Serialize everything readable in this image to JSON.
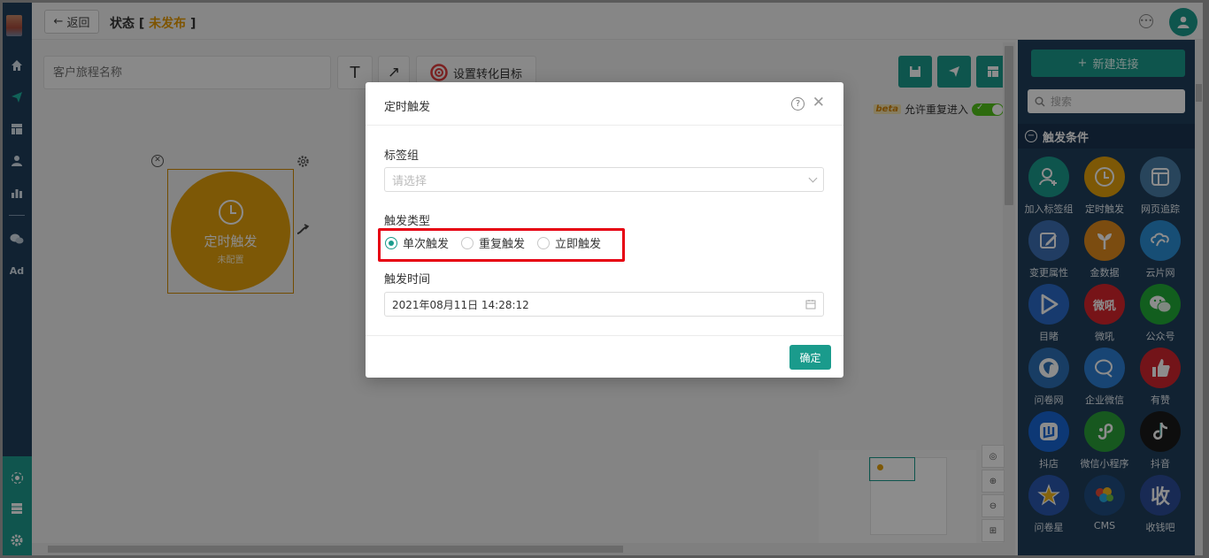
{
  "topbar": {
    "back_label": "返回",
    "status_prefix": "状态 [",
    "status_value": "未发布",
    "status_suffix": "]"
  },
  "leftnav": {
    "ad_label": "Ad",
    "icons": [
      "home-icon",
      "send-icon",
      "layout-icon",
      "user-icon",
      "bar-chart-icon",
      "wechat-icon",
      "settings-network-icon",
      "server-icon",
      "gear-icon"
    ]
  },
  "toolbar": {
    "journey_placeholder": "客户旅程名称",
    "goal_label": "设置转化目标",
    "beta_tag": "beta",
    "allow_reentry_label": "允许重复进入"
  },
  "node": {
    "title": "定时触发",
    "subtitle": "未配置"
  },
  "right_panel": {
    "new_connection_label": "新建连接",
    "search_placeholder": "搜索",
    "section_title": "触发条件",
    "items": [
      {
        "label": "加入标签组",
        "color": "#1a9b8c",
        "icon": "user-add-icon"
      },
      {
        "label": "定时触发",
        "color": "#e4a00b",
        "icon": "clock-icon"
      },
      {
        "label": "网页追踪",
        "color": "#4a7fa8",
        "icon": "webpage-icon"
      },
      {
        "label": "变更属性",
        "color": "#3d6fb5",
        "icon": "edit-icon"
      },
      {
        "label": "金数据",
        "color": "#e08a1e",
        "icon": "plant-icon"
      },
      {
        "label": "云片网",
        "color": "#2b8fd6",
        "icon": "cloud-link-icon"
      },
      {
        "label": "目睹",
        "color": "#2a6bc9",
        "icon": "play-icon"
      },
      {
        "label": "微吼",
        "color": "#d9262c",
        "icon": "weihou-logo",
        "glyph": "微吼"
      },
      {
        "label": "公众号",
        "color": "#22ac38",
        "icon": "wechat-icon"
      },
      {
        "label": "问卷网",
        "color": "#2c6fb7",
        "icon": "survey-icon"
      },
      {
        "label": "企业微信",
        "color": "#2d7fd3",
        "icon": "wecom-icon"
      },
      {
        "label": "有赞",
        "color": "#d2262f",
        "icon": "thumb-up-icon"
      },
      {
        "label": "抖店",
        "color": "#1866d6",
        "icon": "doudian-icon"
      },
      {
        "label": "微信小程序",
        "color": "#2aa03a",
        "icon": "mini-program-icon"
      },
      {
        "label": "抖音",
        "color": "#1b1b1b",
        "icon": "tiktok-icon"
      },
      {
        "label": "问卷星",
        "color": "#2a58b0",
        "icon": "star-icon"
      },
      {
        "label": "CMS",
        "color": "#1f4e82",
        "icon": "cms-icon"
      },
      {
        "label": "收钱吧",
        "color": "#2d4d9a",
        "icon": "shouqianba-logo",
        "glyph": "收"
      }
    ]
  },
  "modal": {
    "title": "定时触发",
    "tag_group_label": "标签组",
    "tag_group_placeholder": "请选择",
    "trigger_type_label": "触发类型",
    "trigger_options": [
      {
        "label": "单次触发",
        "selected": true
      },
      {
        "label": "重复触发",
        "selected": false
      },
      {
        "label": "立即触发",
        "selected": false
      }
    ],
    "trigger_time_label": "触发时间",
    "trigger_time_value": "2021年08月11日 14:28:12",
    "confirm_label": "确定"
  },
  "colors": {
    "accent": "#1a9b8c",
    "nav_bg": "#1f3e5c",
    "node": "#e4a00b",
    "highlight": "#e60012"
  }
}
